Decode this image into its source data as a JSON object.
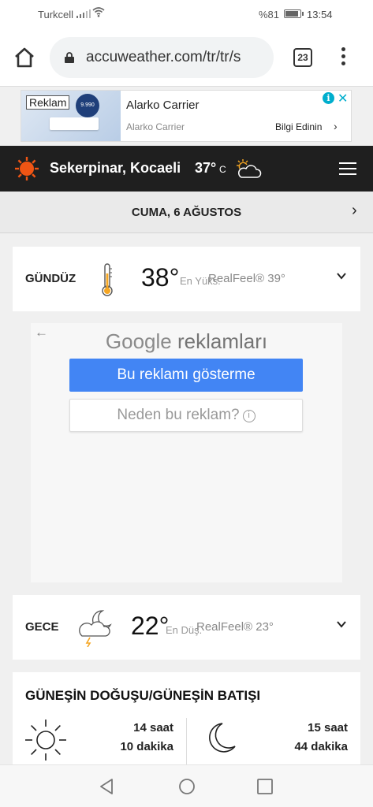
{
  "status": {
    "carrier": "Turkcell",
    "battery": "%81",
    "time": "13:54"
  },
  "browser": {
    "url": "accuweather.com/tr/tr/s",
    "tab_count": "23"
  },
  "ad": {
    "tag": "Reklam",
    "title": "Alarko Carrier",
    "subtitle": "Alarko Carrier",
    "cta": "Bilgi Edinin",
    "badge": "9.990"
  },
  "header": {
    "location": "Sekerpinar, Kocaeli",
    "temp": "37°",
    "unit": "C"
  },
  "date": {
    "label": "CUMA, 6 AĞUSTOS"
  },
  "day": {
    "label": "GÜNDÜZ",
    "temp": "38°",
    "hilo": "En Yüks.",
    "realfeel": "RealFeel® 39°"
  },
  "google_ads": {
    "title_brand": "Google",
    "title_rest": "reklamları",
    "hide_button": "Bu reklamı gösterme",
    "why_button": "Neden bu reklam?"
  },
  "night": {
    "label": "GECE",
    "temp": "22°",
    "hilo": "En Düş.",
    "realfeel": "RealFeel® 23°"
  },
  "sun": {
    "title": "GÜNEŞİN DOĞUŞU/GÜNEŞİN BATIŞI",
    "sun_hours": "14 saat",
    "sun_minutes": "10 dakika",
    "moon_hours": "15 saat",
    "moon_minutes": "44 dakika"
  },
  "colors": {
    "header_bg": "#1f1f1f",
    "accent_orange": "#f05514",
    "google_blue": "#4285f4",
    "ad_info": "#00aecd"
  }
}
